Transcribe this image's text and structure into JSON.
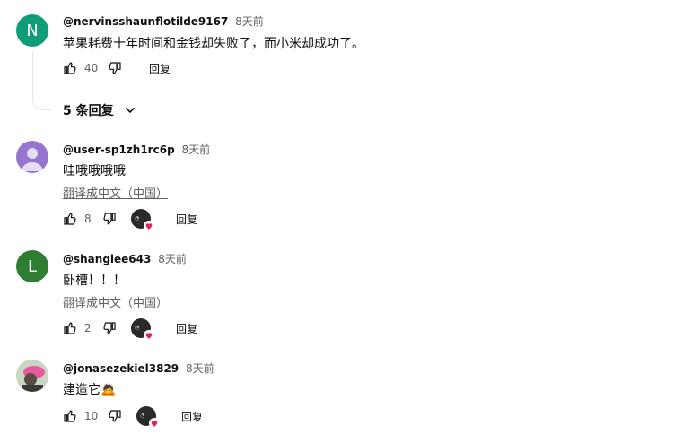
{
  "comments": [
    {
      "avatar_letter": "N",
      "avatar_color": "#0f9d78",
      "handle": "@nervinsshaunflotilde9167",
      "time": "8天前",
      "text": "苹果耗费十年时间和金钱却失败了，而小米却成功了。",
      "likes": "40",
      "reply_label": "回复",
      "replies_label": "5 条回复"
    },
    {
      "avatar_letter": "",
      "avatar_color": "#9575cd",
      "handle": "@user-sp1zh1rc6p",
      "time": "8天前",
      "text": "哇哦哦哦哦",
      "translate_label": "翻译成中文（中国）",
      "likes": "8",
      "reply_label": "回复"
    },
    {
      "avatar_letter": "L",
      "avatar_color": "#2e7d32",
      "handle": "@shanglee643",
      "time": "8天前",
      "text": "卧槽！！！",
      "translate_label": "翻译成中文（中国）",
      "likes": "2",
      "reply_label": "回复"
    },
    {
      "avatar_letter": "",
      "avatar_color": "#d8c8d0",
      "handle": "@jonasezekiel3829",
      "time": "8天前",
      "text": "建造它🙇",
      "likes": "10",
      "reply_label": "回复"
    }
  ],
  "icons": {
    "like": "thumbs-up-icon",
    "dislike": "thumbs-down-icon",
    "expand": "chevron-down-icon",
    "heart": "heart-icon"
  },
  "colors": {
    "heart": "#e0245e",
    "secondary_text": "#606060"
  }
}
